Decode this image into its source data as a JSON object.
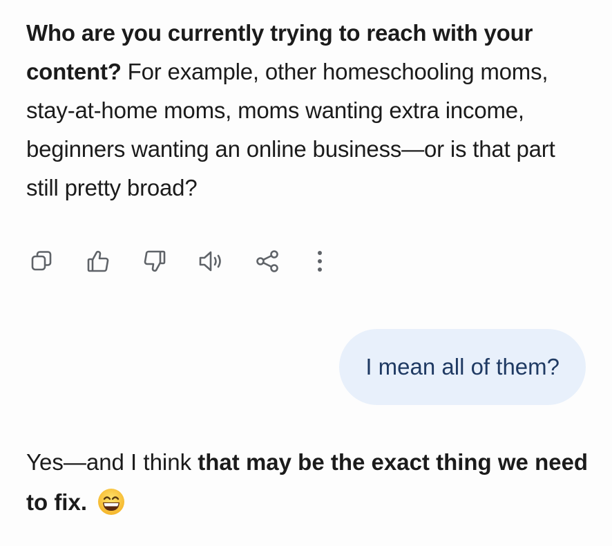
{
  "assistant_message": {
    "bold_lead": "Who are you currently trying to reach with your content?",
    "body": " For example, other homeschooling moms, stay-at-home moms, moms wanting extra income, beginners wanting an online business—or is that part still pretty broad?"
  },
  "message_actions": [
    {
      "icon": "copy-icon"
    },
    {
      "icon": "thumbs-up-icon"
    },
    {
      "icon": "thumbs-down-icon"
    },
    {
      "icon": "speaker-icon"
    },
    {
      "icon": "share-icon"
    },
    {
      "icon": "more-vertical-icon"
    }
  ],
  "user_message": {
    "text": "I mean all of them?"
  },
  "assistant_reply": {
    "lead": "Yes—and I think ",
    "bold": "that may be the exact thing we need to fix.",
    "emoji": "grinning-face-emoji"
  },
  "colors": {
    "user_bubble_bg": "#e8f0fb",
    "user_bubble_text": "#1f3a63",
    "icon": "#5f6368",
    "text": "#1b1b1b"
  }
}
